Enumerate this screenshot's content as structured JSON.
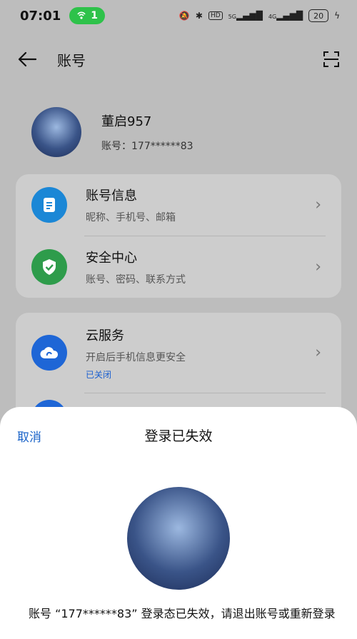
{
  "status": {
    "time": "07:01",
    "hotspot_count": "1",
    "network_hd": "HD",
    "sig1": "5G",
    "sig2": "4G",
    "battery": "20"
  },
  "appbar": {
    "title": "账号"
  },
  "profile": {
    "name": "董启957",
    "account": "账号：177******83"
  },
  "group1": [
    {
      "title": "账号信息",
      "subtitle": "昵称、手机号、邮箱",
      "icon": "document-icon",
      "color": "#1b87d6"
    },
    {
      "title": "安全中心",
      "subtitle": "账号、密码、联系方式",
      "icon": "shield-check-icon",
      "color": "#2e9c4b"
    }
  ],
  "group2": [
    {
      "title": "云服务",
      "subtitle": "开启后手机信息更安全",
      "status": "已关闭",
      "icon": "cloud-icon",
      "color": "#1e66d6"
    }
  ],
  "sheet": {
    "cancel": "取消",
    "title": "登录已失效",
    "message": "账号 “177******83” 登录态已失效，请退出账号或重新登录"
  }
}
